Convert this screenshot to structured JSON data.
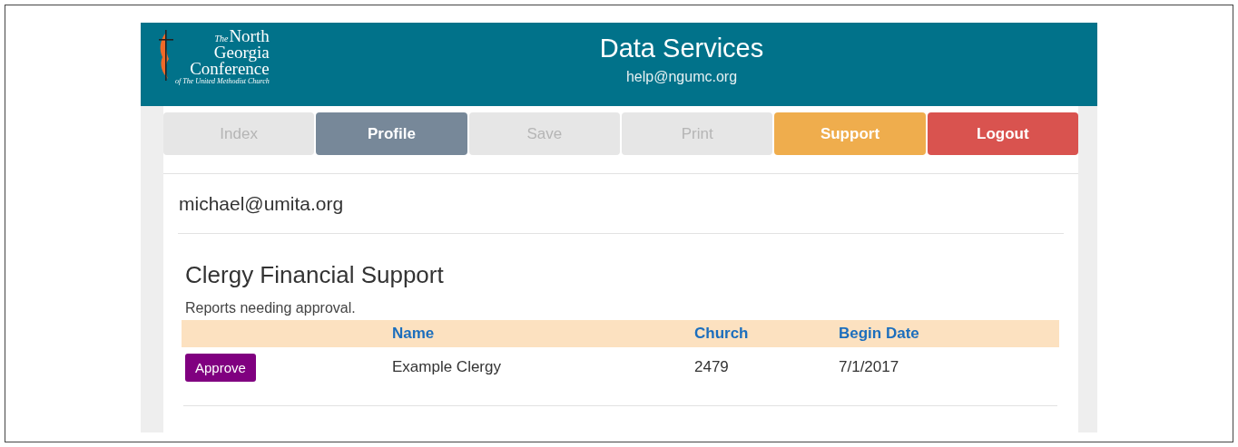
{
  "header": {
    "logo_lines": [
      "The",
      "North",
      "Georgia",
      "Conference",
      "of The United Methodist Church"
    ],
    "title": "Data Services",
    "email": "help@ngumc.org"
  },
  "nav": [
    {
      "label": "Index",
      "kind": "disabled"
    },
    {
      "label": "Profile",
      "kind": "current"
    },
    {
      "label": "Save",
      "kind": "disabled"
    },
    {
      "label": "Print",
      "kind": "disabled"
    },
    {
      "label": "Support",
      "kind": "warning"
    },
    {
      "label": "Logout",
      "kind": "danger"
    }
  ],
  "user": "michael@umita.org",
  "section": {
    "title": "Clergy Financial Support",
    "subtitle": "Reports needing approval.",
    "table": {
      "columns": [
        "Name",
        "Church",
        "Begin Date"
      ],
      "rows": [
        {
          "action": "Approve",
          "cells": [
            "Example Clergy",
            "2479",
            "7/1/2017"
          ]
        }
      ]
    }
  }
}
